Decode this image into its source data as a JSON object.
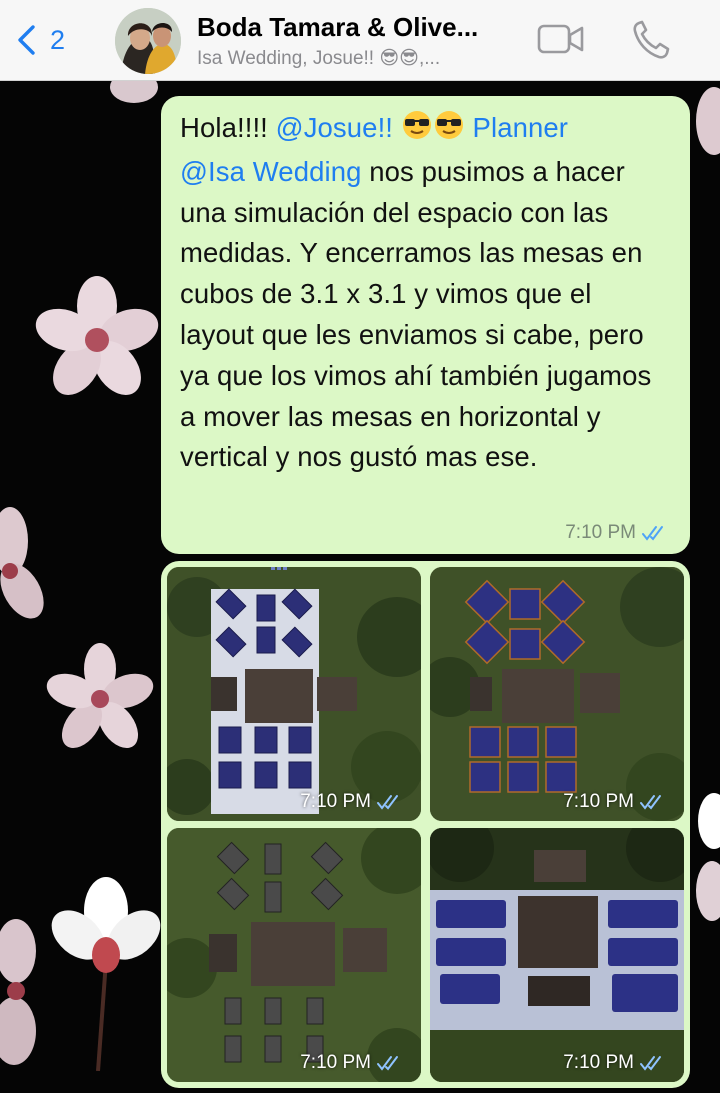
{
  "header": {
    "back_count": "2",
    "title": "Boda Tamara & Olive...",
    "subtitle": "Isa Wedding, Josue!! 😎😎,...",
    "icons": [
      "chevron-left-icon",
      "video-camera-icon",
      "phone-icon"
    ],
    "accent_color": "#1f7ef0"
  },
  "message": {
    "text_parts": [
      "Hola!!!! ",
      "@Josue!! ",
      " Planner",
      "@Isa Wedding",
      "  nos pusimos a hacer una simulación del espacio con las medidas. Y encerramos las mesas en cubos de 3.1 x 3.1 y vimos que el layout que les enviamos si cabe, pero ya que los vimos ahí también jugamos a mover las mesas en horizontal y vertical y nos gustó  mas ese."
    ],
    "time": "7:10 PM",
    "status": "read"
  },
  "gallery": {
    "items": [
      {
        "time": "7:10 PM",
        "status": "read"
      },
      {
        "time": "7:10 PM",
        "status": "read"
      },
      {
        "time": "7:10 PM",
        "status": "read"
      },
      {
        "time": "7:10 PM",
        "status": "read"
      }
    ]
  },
  "colors": {
    "bubble": "#dcf8c6",
    "header_bg": "#f7f7f7",
    "read_check": "#4fa3f7"
  }
}
